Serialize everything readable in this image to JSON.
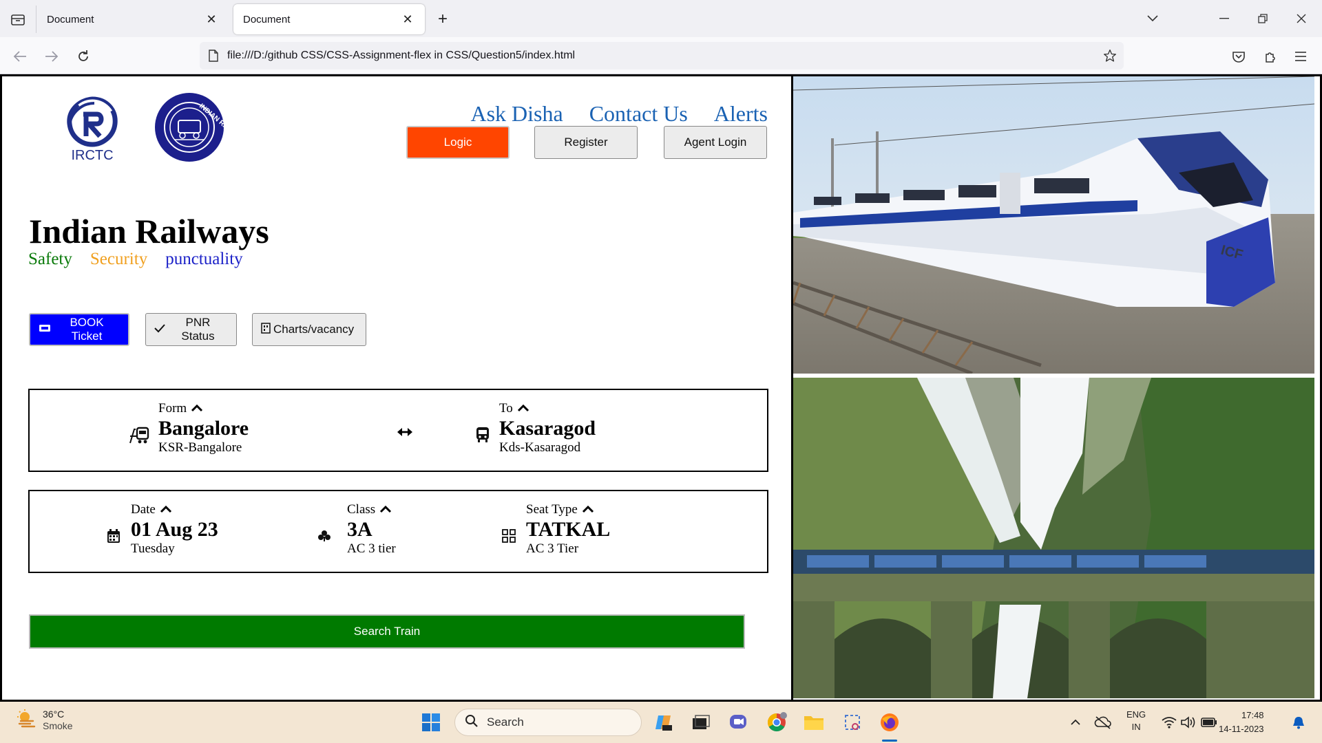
{
  "browser": {
    "tabs": [
      {
        "title": "Document",
        "active": false
      },
      {
        "title": "Document",
        "active": true
      }
    ],
    "url": "file:///D:/github CSS/CSS-Assignment-flex in CSS/Question5/index.html"
  },
  "header": {
    "irctc_logo_text": "IRCTC",
    "indian_railways_logo_text": "INDIAN RAILWAYS",
    "links": [
      "Ask Disha",
      "Contact Us",
      "Alerts"
    ],
    "buttons": {
      "login": "Logic",
      "register": "Register",
      "agent": "Agent Login"
    }
  },
  "hero": {
    "title": "Indian Railways",
    "taglines": {
      "safety": "Safety",
      "security": "Security",
      "punctuality": "punctuality"
    }
  },
  "modes": {
    "book": "BOOK Ticket",
    "pnr": "PNR Status",
    "charts": "Charts/vacancy"
  },
  "route": {
    "from": {
      "label": "Form",
      "value": "Bangalore",
      "sub": "KSR-Bangalore"
    },
    "to": {
      "label": "To",
      "value": "Kasaragod",
      "sub": "Kds-Kasaragod"
    }
  },
  "journey": {
    "date": {
      "label": "Date",
      "value": "01 Aug 23",
      "sub": "Tuesday"
    },
    "class": {
      "label": "Class",
      "value": "3A",
      "sub": "AC 3 tier"
    },
    "seat": {
      "label": "Seat Type",
      "value": "TATKAL",
      "sub": "AC 3 Tier"
    }
  },
  "search_button": "Search Train",
  "photos": {
    "train_marking": "ICF"
  },
  "taskbar": {
    "weather": {
      "temp": "36°C",
      "condition": "Smoke"
    },
    "search_placeholder": "Search",
    "language": {
      "line1": "ENG",
      "line2": "IN"
    },
    "time": "17:48",
    "date": "14-11-2023"
  },
  "colors": {
    "login_button": "#ff4500",
    "book_button": "#0000ff",
    "search_button": "#007a00",
    "link": "#1a62b3",
    "safety": "#0a7a0a",
    "security": "#f0a020",
    "punctuality": "#1c22c8"
  }
}
